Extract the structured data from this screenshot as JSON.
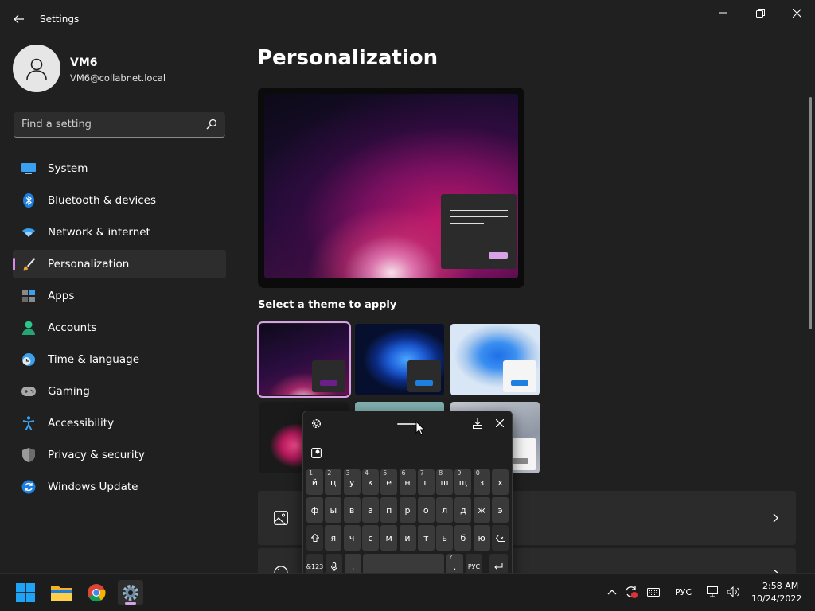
{
  "window": {
    "title": "Settings"
  },
  "user": {
    "name": "VM6",
    "email": "VM6@collabnet.local"
  },
  "search": {
    "placeholder": "Find a setting"
  },
  "nav": [
    {
      "label": "System",
      "icon": "monitor-icon"
    },
    {
      "label": "Bluetooth & devices",
      "icon": "bluetooth-icon"
    },
    {
      "label": "Network & internet",
      "icon": "wifi-icon"
    },
    {
      "label": "Personalization",
      "icon": "brush-icon",
      "active": true
    },
    {
      "label": "Apps",
      "icon": "apps-icon"
    },
    {
      "label": "Accounts",
      "icon": "person-icon"
    },
    {
      "label": "Time & language",
      "icon": "clock-globe-icon"
    },
    {
      "label": "Gaming",
      "icon": "gamepad-icon"
    },
    {
      "label": "Accessibility",
      "icon": "accessibility-icon"
    },
    {
      "label": "Privacy & security",
      "icon": "shield-icon"
    },
    {
      "label": "Windows Update",
      "icon": "update-icon"
    }
  ],
  "main": {
    "title": "Personalization",
    "themes_label": "Select a theme to apply"
  },
  "keyboard": {
    "row1": [
      {
        "k": "й",
        "n": "1"
      },
      {
        "k": "ц",
        "n": "2"
      },
      {
        "k": "у",
        "n": "3"
      },
      {
        "k": "к",
        "n": "4"
      },
      {
        "k": "е",
        "n": "5"
      },
      {
        "k": "н",
        "n": "6"
      },
      {
        "k": "г",
        "n": "7"
      },
      {
        "k": "ш",
        "n": "8"
      },
      {
        "k": "щ",
        "n": "9"
      },
      {
        "k": "з",
        "n": "0"
      },
      {
        "k": "х",
        "n": ""
      }
    ],
    "row2": [
      "ф",
      "ы",
      "в",
      "а",
      "п",
      "р",
      "о",
      "л",
      "д",
      "ж",
      "э"
    ],
    "row3": [
      "я",
      "ч",
      "с",
      "м",
      "и",
      "т",
      "ь",
      "б",
      "ю"
    ],
    "symbols_label": "&123",
    "comma": ",",
    "period": ".",
    "period_hint": "?",
    "lang_key": "РУС"
  },
  "taskbar": {
    "language": "РУС",
    "time": "2:58 AM",
    "date": "10/24/2022"
  },
  "colors": {
    "accent": "#d6a2e5",
    "background": "#202020",
    "card": "#2b2b2b"
  }
}
